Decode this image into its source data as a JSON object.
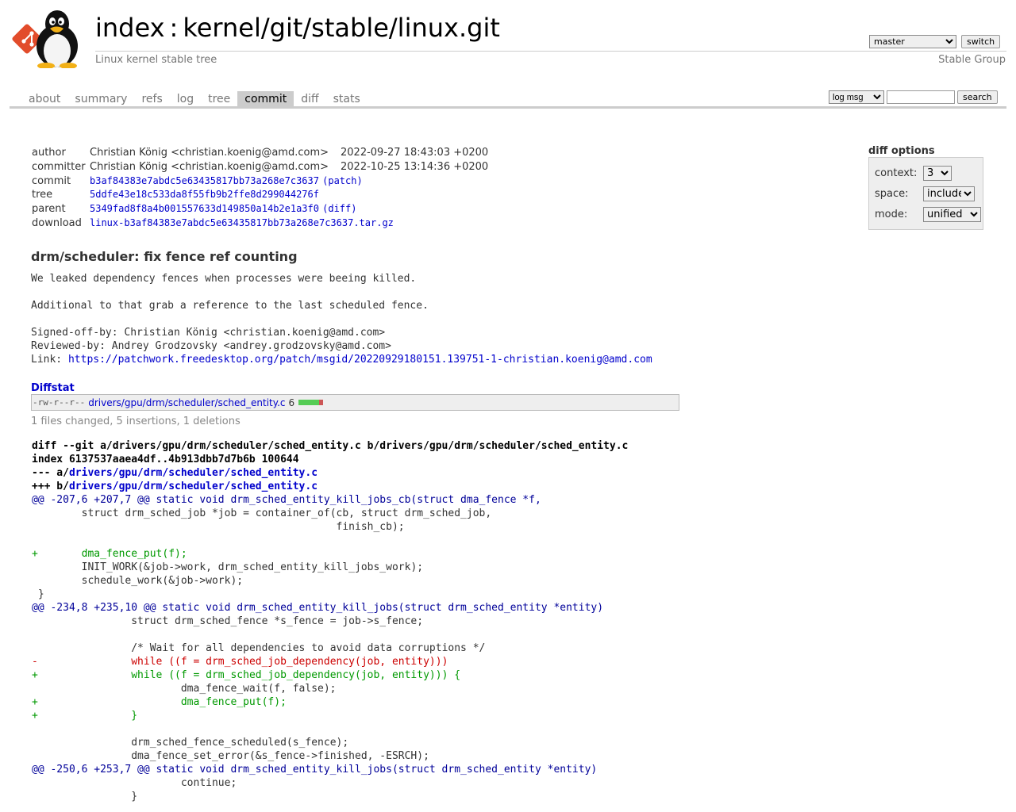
{
  "header": {
    "index_label": "index",
    "separator": ":",
    "repo_path": "kernel/git/stable/linux.git",
    "subtitle": "Linux kernel stable tree",
    "owner": "Stable Group",
    "branch_selected": "master",
    "switch_label": "switch"
  },
  "tabs": [
    {
      "label": "about",
      "active": false
    },
    {
      "label": "summary",
      "active": false
    },
    {
      "label": "refs",
      "active": false
    },
    {
      "label": "log",
      "active": false
    },
    {
      "label": "tree",
      "active": false
    },
    {
      "label": "commit",
      "active": true
    },
    {
      "label": "diff",
      "active": false
    },
    {
      "label": "stats",
      "active": false
    }
  ],
  "search": {
    "type_selected": "log msg",
    "query": "",
    "button_label": "search"
  },
  "diff_options": {
    "title": "diff options",
    "context_label": "context:",
    "context_value": "3",
    "space_label": "space:",
    "space_value": "include",
    "mode_label": "mode:",
    "mode_value": "unified"
  },
  "commit_info": {
    "author_key": "author",
    "author": "Christian König <christian.koenig@amd.com>",
    "author_date": "2022-09-27 18:43:03 +0200",
    "committer_key": "committer",
    "committer": "Christian König <christian.koenig@amd.com>",
    "committer_date": "2022-10-25 13:14:36 +0200",
    "commit_key": "commit",
    "commit_hash": "b3af84383e7abdc5e63435817bb73a268e7c3637",
    "commit_extra": "(patch)",
    "tree_key": "tree",
    "tree_hash": "5ddfe43e18c533da8f55fb9b2ffe8d299044276f",
    "parent_key": "parent",
    "parent_hash": "5349fad8f8a4b001557633d149850a14b2e1a3f0",
    "parent_extra": "(diff)",
    "download_key": "download",
    "download_file": "linux-b3af84383e7abdc5e63435817bb73a268e7c3637.tar.gz"
  },
  "message": {
    "subject": "drm/scheduler: fix fence ref counting",
    "body_line1": "We leaked dependency fences when processes were beeing killed.",
    "body_line2": "Additional to that grab a reference to the last scheduled fence.",
    "signed_off": "Signed-off-by: Christian König <christian.koenig@amd.com>",
    "reviewed": "Reviewed-by: Andrey Grodzovsky <andrey.grodzovsky@amd.com>",
    "link_prefix": "Link: ",
    "link_url": "https://patchwork.freedesktop.org/patch/msgid/20220929180151.139751-1-christian.koenig@amd.com"
  },
  "diffstat": {
    "title": "Diffstat",
    "mode": "-rw-r--r--",
    "file": "drivers/gpu/drm/scheduler/sched_entity.c",
    "changes": "6",
    "insertions": 5,
    "deletions": 1,
    "summary": "1 files changed, 5 insertions, 1 deletions"
  },
  "diff": {
    "line1": "diff --git a/drivers/gpu/drm/scheduler/sched_entity.c b/drivers/gpu/drm/scheduler/sched_entity.c",
    "line2": "index 6137537aaea4df..4b913dbb7d7b6b 100644",
    "minus_prefix": "--- a/",
    "plus_prefix": "+++ b/",
    "file_link": "drivers/gpu/drm/scheduler/sched_entity.c",
    "lines": [
      {
        "t": "hunk",
        "s": "@@ -207,6 +207,7 @@ static void drm_sched_entity_kill_jobs_cb(struct dma_fence *f,"
      },
      {
        "t": "ctx",
        "s": " \tstruct drm_sched_job *job = container_of(cb, struct drm_sched_job,"
      },
      {
        "t": "ctx",
        "s": " \t\t\t\t\t\t finish_cb);"
      },
      {
        "t": "ctx",
        "s": " "
      },
      {
        "t": "add",
        "s": "+\tdma_fence_put(f);"
      },
      {
        "t": "ctx",
        "s": " \tINIT_WORK(&job->work, drm_sched_entity_kill_jobs_work);"
      },
      {
        "t": "ctx",
        "s": " \tschedule_work(&job->work);"
      },
      {
        "t": "ctx",
        "s": " }"
      },
      {
        "t": "hunk",
        "s": "@@ -234,8 +235,10 @@ static void drm_sched_entity_kill_jobs(struct drm_sched_entity *entity)"
      },
      {
        "t": "ctx",
        "s": " \t\tstruct drm_sched_fence *s_fence = job->s_fence;"
      },
      {
        "t": "ctx",
        "s": " "
      },
      {
        "t": "ctx",
        "s": " \t\t/* Wait for all dependencies to avoid data corruptions */"
      },
      {
        "t": "del",
        "s": "-\t\twhile ((f = drm_sched_job_dependency(job, entity)))"
      },
      {
        "t": "add",
        "s": "+\t\twhile ((f = drm_sched_job_dependency(job, entity))) {"
      },
      {
        "t": "ctx",
        "s": " \t\t\tdma_fence_wait(f, false);"
      },
      {
        "t": "add",
        "s": "+\t\t\tdma_fence_put(f);"
      },
      {
        "t": "add",
        "s": "+\t\t}"
      },
      {
        "t": "ctx",
        "s": " "
      },
      {
        "t": "ctx",
        "s": " \t\tdrm_sched_fence_scheduled(s_fence);"
      },
      {
        "t": "ctx",
        "s": " \t\tdma_fence_set_error(&s_fence->finished, -ESRCH);"
      },
      {
        "t": "hunk",
        "s": "@@ -250,6 +253,7 @@ static void drm_sched_entity_kill_jobs(struct drm_sched_entity *entity)"
      },
      {
        "t": "ctx",
        "s": " \t\t\tcontinue;"
      },
      {
        "t": "ctx",
        "s": " \t\t}"
      }
    ]
  },
  "colors": {
    "link": "#0000cc",
    "added": "#009900",
    "deleted": "#cc0000",
    "hunk": "#000099",
    "tab_active_bg": "#cccccc"
  },
  "icons": {
    "git_logo": "git-diamond-logo",
    "tux": "tux-penguin-logo"
  }
}
